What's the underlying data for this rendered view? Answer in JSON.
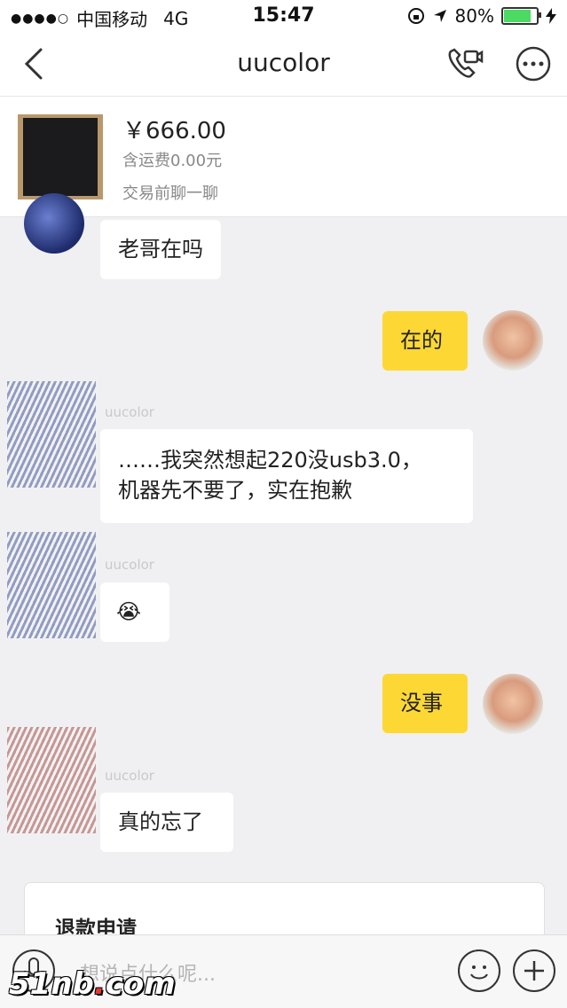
{
  "status_bar": {
    "signal": "●●●●○",
    "carrier": "中国移动",
    "network": "4G",
    "time": "15:47",
    "battery": "80%",
    "battery_level": 0.8
  },
  "nav": {
    "title": "uucolor"
  },
  "product": {
    "price": "￥666.00",
    "shipping": "含运费0.00元",
    "note": "交易前聊一聊"
  },
  "messages": [
    {
      "from": "other",
      "text": "老哥在吗"
    },
    {
      "from": "me",
      "text": "在的"
    },
    {
      "from": "other",
      "name": "uucolor",
      "text_line1": "……我突然想起220没usb3.0，",
      "text_line2": "机器先不要了，实在抱歉"
    },
    {
      "from": "other",
      "name": "uucolor",
      "emoji": "😭"
    },
    {
      "from": "me",
      "text": "没事"
    },
    {
      "from": "other",
      "name": "uucolor",
      "text": "真的忘了"
    }
  ],
  "refund_card": {
    "title": "退款申请"
  },
  "input": {
    "placeholder": "想说点什么呢..."
  },
  "watermark": {
    "prefix": "51nb",
    "dot": ".",
    "suffix": "com"
  },
  "colors": {
    "my_bubble": "#fdd835",
    "background": "#f0f0f2",
    "battery_green": "#4cd964"
  }
}
